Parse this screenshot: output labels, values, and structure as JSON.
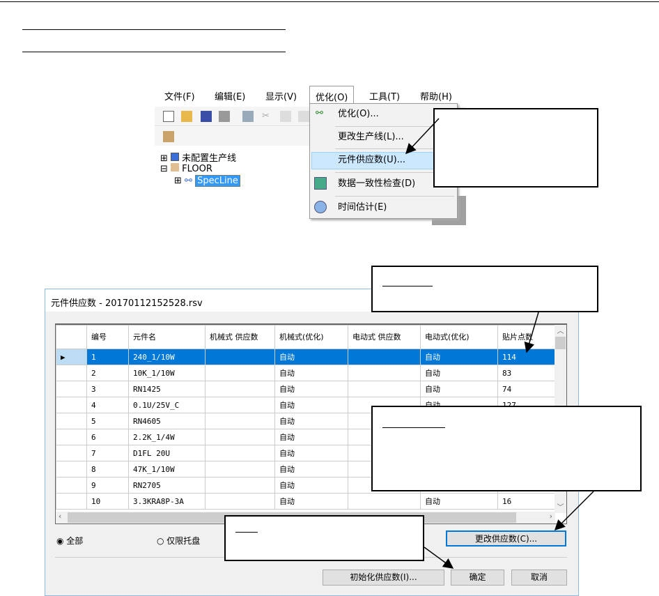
{
  "menu": {
    "items": [
      "文件(F)",
      "编辑(E)",
      "显示(V)",
      "优化(O)",
      "工具(T)",
      "帮助(H)"
    ],
    "dropdown": [
      "优化(O)...",
      "更改生产线(L)...",
      "元件供应数(U)...",
      "数据一致性检查(D)",
      "时间估计(E)"
    ]
  },
  "tree": [
    "未配置生产线",
    "FLOOR",
    "SpecLine"
  ],
  "dialog": {
    "title": "元件供应数 - 20170112152528.rsv",
    "columns": [
      "编号",
      "元件名",
      "机械式 供应数",
      "机械式(优化)",
      "电动式 供应数",
      "电动式(优化)",
      "贴片点数"
    ],
    "rows": [
      [
        "1",
        "240_1/10W",
        "",
        "自动",
        "",
        "自动",
        "114"
      ],
      [
        "2",
        "10K_1/10W",
        "",
        "自动",
        "",
        "自动",
        "83"
      ],
      [
        "3",
        "RN1425",
        "",
        "自动",
        "",
        "自动",
        "74"
      ],
      [
        "4",
        "0.1U/25V_C",
        "",
        "自动",
        "",
        "自动",
        "127"
      ],
      [
        "5",
        "RN4605",
        "",
        "自动",
        "",
        "",
        ""
      ],
      [
        "6",
        "2.2K_1/4W",
        "",
        "自动",
        "",
        "",
        ""
      ],
      [
        "7",
        "D1FL 20U",
        "",
        "自动",
        "",
        "",
        ""
      ],
      [
        "8",
        "47K_1/10W",
        "",
        "自动",
        "",
        "",
        ""
      ],
      [
        "9",
        "RN2705",
        "",
        "自动",
        "",
        "",
        ""
      ],
      [
        "10",
        "3.3KRA8P-3A",
        "",
        "自动",
        "",
        "自动",
        "16"
      ]
    ],
    "radio_all": "全部",
    "radio_tray": "仅限托盘",
    "change_btn": "更改供应数(C)...",
    "init_btn": "初始化供应数(I)...",
    "ok_btn": "确定",
    "cancel_btn": "取消"
  }
}
